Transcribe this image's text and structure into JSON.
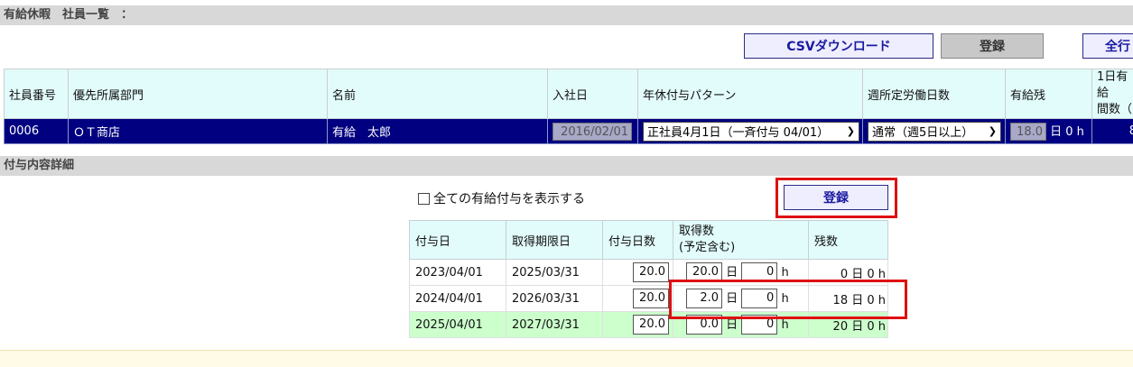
{
  "header": {
    "title": "有給休暇　社員一覧　："
  },
  "toolbar": {
    "csv_label": "CSVダウンロード",
    "register_label": "登録",
    "all_label": "全行"
  },
  "employee_table": {
    "headers": [
      "社員番号",
      "優先所属部門",
      "名前",
      "入社日",
      "年休付与パターン",
      "週所定労働日数",
      "有給残",
      "1日有給\n間数（"
    ],
    "row": {
      "id": "0006",
      "department": "ＯＴ商店",
      "name": "有給　太郎",
      "hire_date": "2016/02/01",
      "pattern": "正社員4月1日（一斉付与 04/01）",
      "weekly_days": "通常（週5日以上）",
      "remaining_days": "18.0",
      "remaining_unit": "日 0 h",
      "daily_hours": "8"
    }
  },
  "detail": {
    "title": "付与内容詳細",
    "show_all_label": "全ての有給付与を表示する",
    "show_all_checked": false,
    "register_label": "登録",
    "headers": [
      "付与日",
      "取得期限日",
      "付与日数",
      "取得数\n(予定含む)",
      "残数"
    ],
    "rows": [
      {
        "grant_date": "2023/04/01",
        "expiry": "2025/03/31",
        "grant_days": "20.0",
        "taken_days": "20.0",
        "taken_hours": "0",
        "remaining": "0 日 0 h",
        "highlight": false
      },
      {
        "grant_date": "2024/04/01",
        "expiry": "2026/03/31",
        "grant_days": "20.0",
        "taken_days": "2.0",
        "taken_hours": "0",
        "remaining": "18 日 0 h",
        "highlight": false
      },
      {
        "grant_date": "2025/04/01",
        "expiry": "2027/03/31",
        "grant_days": "20.0",
        "taken_days": "0.0",
        "taken_hours": "0",
        "remaining": "20 日 0 h",
        "highlight": true
      }
    ],
    "day_unit": "日",
    "hour_unit": "h"
  },
  "colors": {
    "selected_row": "#000080",
    "header_bg": "#e2fbfb",
    "highlight_row": "#ccffcc",
    "annotation": "#e01010"
  }
}
